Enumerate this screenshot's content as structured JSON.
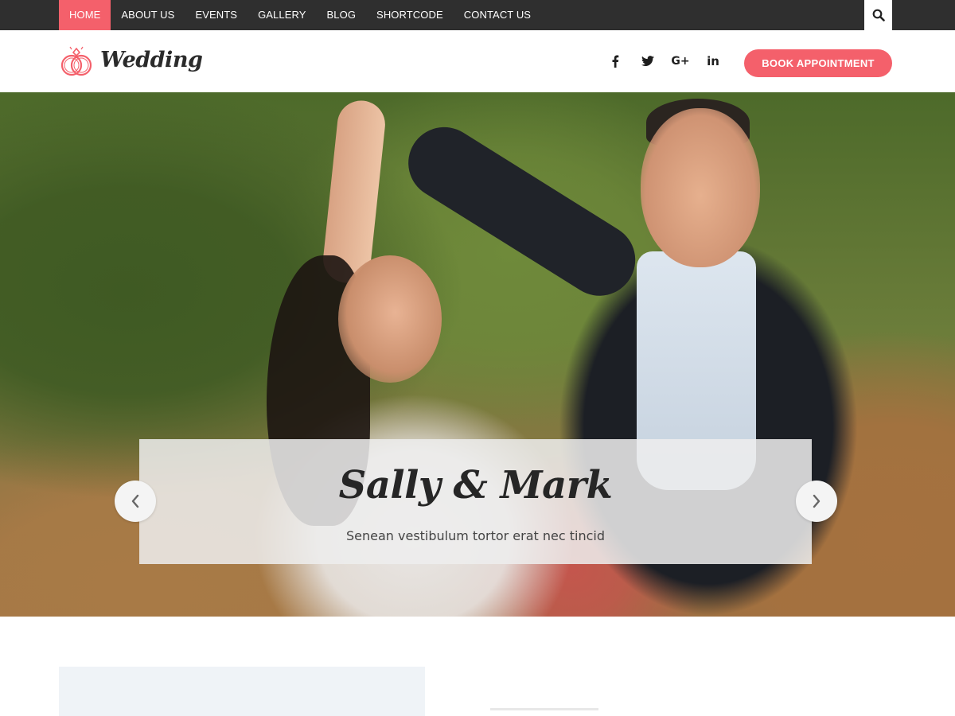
{
  "nav": {
    "items": [
      {
        "label": "HOME",
        "active": true
      },
      {
        "label": "ABOUT US"
      },
      {
        "label": "EVENTS"
      },
      {
        "label": "GALLERY"
      },
      {
        "label": "BLOG"
      },
      {
        "label": "SHORTCODE"
      },
      {
        "label": "CONTACT US"
      }
    ],
    "search_icon": "search-icon"
  },
  "header": {
    "logo_text": "Wedding",
    "logo_icon": "rings-icon",
    "social": [
      {
        "icon": "facebook-icon",
        "glyph": "f"
      },
      {
        "icon": "twitter-icon",
        "glyph": "t"
      },
      {
        "icon": "google-plus-icon",
        "glyph": "G+"
      },
      {
        "icon": "linkedin-icon",
        "glyph": "in"
      }
    ],
    "cta_label": "BOOK APPOINTMENT"
  },
  "hero": {
    "title": "Sally & Mark",
    "subtitle": "Senean vestibulum tortor erat nec tincid",
    "prev_icon": "chevron-left-icon",
    "next_icon": "chevron-right-icon"
  },
  "colors": {
    "accent": "#f4606b",
    "topbar": "#2f2f2f",
    "text_dark": "#262626"
  }
}
